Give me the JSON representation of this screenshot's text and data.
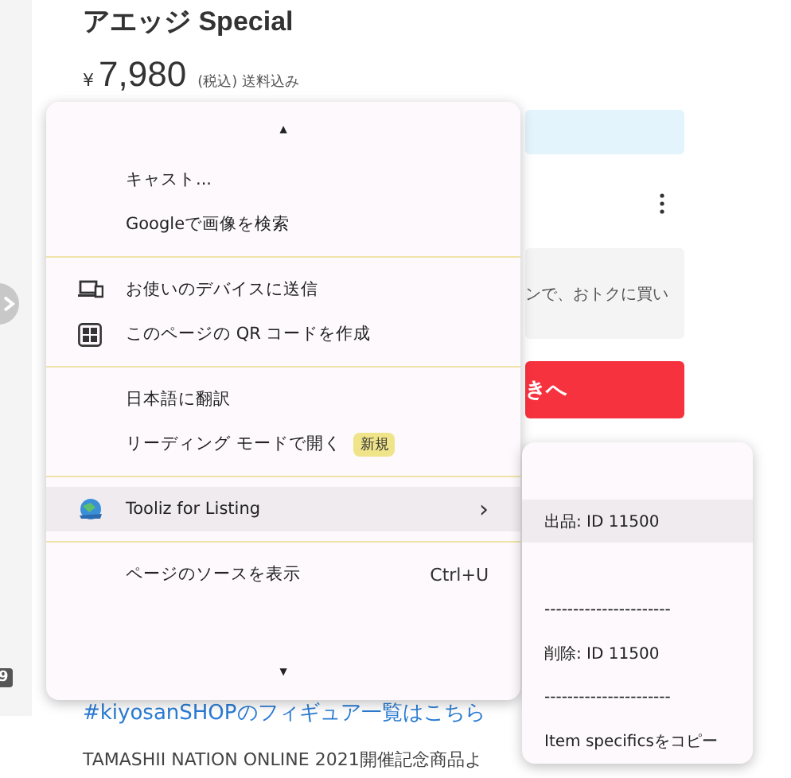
{
  "page": {
    "title": "アエッジ Special",
    "price_currency": "¥",
    "price": "7,980",
    "price_note": "(税込) 送料込み",
    "coupon_text": "ンで、おトクに買い",
    "buy_button": "きへ",
    "link": "#kiyosanSHOPのフィギュア一覧はこちら",
    "footer_text": "TAMASHII NATION ONLINE 2021開催記念商品よ",
    "badge": "9"
  },
  "context_menu": {
    "scroll_up": "▲",
    "scroll_down": "▼",
    "groups": [
      [
        {
          "label": "キャスト...",
          "highlighted": false
        },
        {
          "label": "Googleで画像を検索",
          "highlighted": false
        }
      ],
      [
        {
          "label": "お使いのデバイスに送信",
          "highlighted": false
        },
        {
          "label": "このページの QR コードを作成",
          "highlighted": false
        }
      ],
      [
        {
          "label": "日本語に翻訳",
          "highlighted": false
        },
        {
          "label": "リーディング モードで開く",
          "badge": "新規",
          "highlighted": false
        }
      ],
      [
        {
          "label": "Tooliz for Listing",
          "submenu": "›",
          "highlighted": true
        }
      ],
      [
        {
          "label": "ページのソースを表示",
          "shortcut": "Ctrl+U",
          "highlighted": false
        }
      ]
    ]
  },
  "submenu": {
    "items": [
      {
        "kind": "blank",
        "highlighted": false
      },
      {
        "kind": "item",
        "label": "出品: ID 11500",
        "highlighted": true
      },
      {
        "kind": "blank",
        "highlighted": false
      },
      {
        "kind": "item",
        "label": "----------------------",
        "highlighted": false
      },
      {
        "kind": "item",
        "label": "削除: ID 11500",
        "highlighted": false
      },
      {
        "kind": "item",
        "label": "----------------------",
        "highlighted": false
      },
      {
        "kind": "item",
        "label": "Item specificsをコピー",
        "highlighted": false
      }
    ]
  }
}
